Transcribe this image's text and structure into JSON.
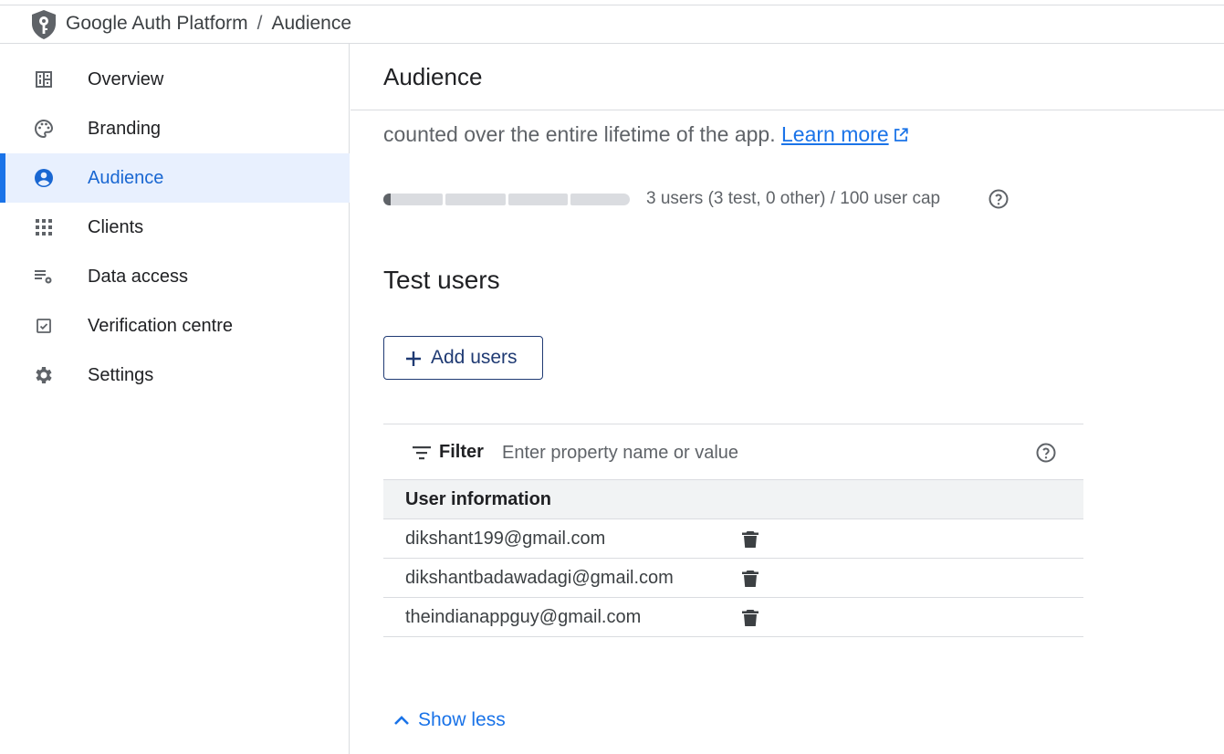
{
  "header": {
    "product": "Google Auth Platform",
    "separator": "/",
    "current": "Audience"
  },
  "sidebar": {
    "items": [
      {
        "label": "Overview",
        "icon": "dashboard-icon"
      },
      {
        "label": "Branding",
        "icon": "palette-icon"
      },
      {
        "label": "Audience",
        "icon": "account-circle-icon",
        "active": true
      },
      {
        "label": "Clients",
        "icon": "apps-grid-icon"
      },
      {
        "label": "Data access",
        "icon": "data-settings-icon"
      },
      {
        "label": "Verification centre",
        "icon": "verified-checkbox-icon"
      },
      {
        "label": "Settings",
        "icon": "gear-icon"
      }
    ]
  },
  "main": {
    "title": "Audience",
    "description": "counted over the entire lifetime of the app.",
    "learn_more": "Learn more",
    "usage": {
      "text": "3 users (3 test, 0 other) / 100 user cap",
      "fraction": 0.03
    },
    "test_users": {
      "title": "Test users",
      "add_button": "Add users",
      "filter_label": "Filter",
      "filter_placeholder": "Enter property name or value",
      "column_header": "User information",
      "rows": [
        {
          "email": "dikshant199@gmail.com"
        },
        {
          "email": "dikshantbadawadagi@gmail.com"
        },
        {
          "email": "theindianappguy@gmail.com"
        }
      ]
    },
    "show_less": "Show less"
  },
  "colors": {
    "accent": "#1a73e8",
    "active_bg": "#e8f0fe",
    "button_border": "#1f3a73"
  }
}
